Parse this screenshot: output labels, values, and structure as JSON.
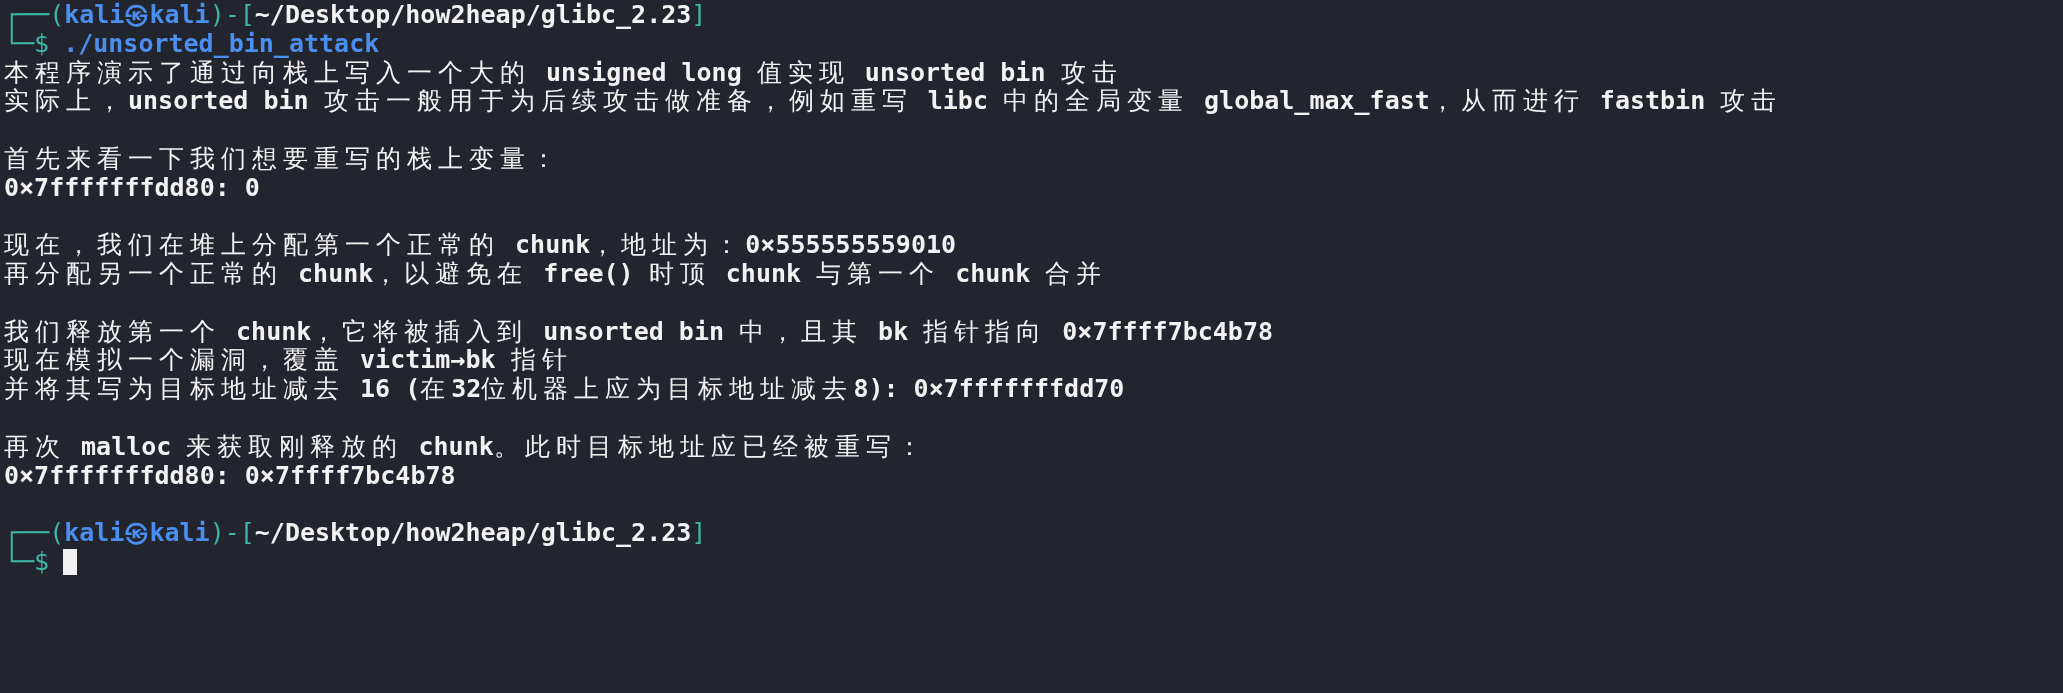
{
  "terminal": {
    "lines": [
      {
        "kind": "prompt-head",
        "open": "┌──(",
        "user": "kali㉿kali",
        "mid": ")-[",
        "path": "~/Desktop/how2heap/glibc_2.23",
        "close": "]"
      },
      {
        "kind": "prompt",
        "sign": "└─$",
        "command": "./unsorted_bin_attack",
        "cursor": false
      },
      {
        "kind": "output",
        "text": "本程序演示了通过向栈上写入一个大的 unsigned long 值实现 unsorted bin 攻击"
      },
      {
        "kind": "output",
        "text": "实际上，unsorted bin 攻击一般用于为后续攻击做准备，例如重写 libc 中的全局变量 global_max_fast，从而进行 fastbin 攻击"
      },
      {
        "kind": "blank"
      },
      {
        "kind": "output",
        "text": "首先来看一下我们想要重写的栈上变量："
      },
      {
        "kind": "output",
        "text": "0×7fffffffdd80: 0"
      },
      {
        "kind": "blank"
      },
      {
        "kind": "output",
        "text": "现在，我们在堆上分配第一个正常的 chunk，地址为：0×555555559010"
      },
      {
        "kind": "output",
        "text": "再分配另一个正常的 chunk，以避免在 free() 时顶 chunk 与第一个 chunk 合并"
      },
      {
        "kind": "blank"
      },
      {
        "kind": "output",
        "text": "我们释放第一个 chunk，它将被插入到 unsorted bin 中，且其 bk 指针指向 0×7ffff7bc4b78"
      },
      {
        "kind": "output",
        "text": "现在模拟一个漏洞，覆盖 victim→bk 指针"
      },
      {
        "kind": "output",
        "text": "并将其写为目标地址减去 16 (在32位机器上应为目标地址减去8): 0×7fffffffdd70"
      },
      {
        "kind": "blank"
      },
      {
        "kind": "output",
        "text": "再次 malloc 来获取刚释放的 chunk。此时目标地址应已经被重写："
      },
      {
        "kind": "output",
        "text": "0×7fffffffdd80: 0×7ffff7bc4b78"
      },
      {
        "kind": "blank"
      },
      {
        "kind": "prompt-head",
        "open": "┌──(",
        "user": "kali㉿kali",
        "mid": ")-[",
        "path": "~/Desktop/how2heap/glibc_2.23",
        "close": "]"
      },
      {
        "kind": "prompt",
        "sign": "└─$",
        "cursor": true
      }
    ]
  }
}
